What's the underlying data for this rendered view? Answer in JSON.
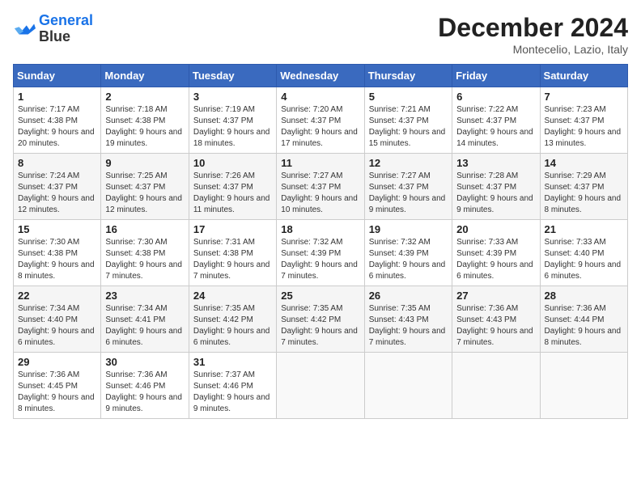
{
  "header": {
    "logo_line1": "General",
    "logo_line2": "Blue",
    "month": "December 2024",
    "location": "Montecelio, Lazio, Italy"
  },
  "weekdays": [
    "Sunday",
    "Monday",
    "Tuesday",
    "Wednesday",
    "Thursday",
    "Friday",
    "Saturday"
  ],
  "weeks": [
    [
      {
        "day": "1",
        "info": "Sunrise: 7:17 AM\nSunset: 4:38 PM\nDaylight: 9 hours and 20 minutes."
      },
      {
        "day": "2",
        "info": "Sunrise: 7:18 AM\nSunset: 4:38 PM\nDaylight: 9 hours and 19 minutes."
      },
      {
        "day": "3",
        "info": "Sunrise: 7:19 AM\nSunset: 4:37 PM\nDaylight: 9 hours and 18 minutes."
      },
      {
        "day": "4",
        "info": "Sunrise: 7:20 AM\nSunset: 4:37 PM\nDaylight: 9 hours and 17 minutes."
      },
      {
        "day": "5",
        "info": "Sunrise: 7:21 AM\nSunset: 4:37 PM\nDaylight: 9 hours and 15 minutes."
      },
      {
        "day": "6",
        "info": "Sunrise: 7:22 AM\nSunset: 4:37 PM\nDaylight: 9 hours and 14 minutes."
      },
      {
        "day": "7",
        "info": "Sunrise: 7:23 AM\nSunset: 4:37 PM\nDaylight: 9 hours and 13 minutes."
      }
    ],
    [
      {
        "day": "8",
        "info": "Sunrise: 7:24 AM\nSunset: 4:37 PM\nDaylight: 9 hours and 12 minutes."
      },
      {
        "day": "9",
        "info": "Sunrise: 7:25 AM\nSunset: 4:37 PM\nDaylight: 9 hours and 12 minutes."
      },
      {
        "day": "10",
        "info": "Sunrise: 7:26 AM\nSunset: 4:37 PM\nDaylight: 9 hours and 11 minutes."
      },
      {
        "day": "11",
        "info": "Sunrise: 7:27 AM\nSunset: 4:37 PM\nDaylight: 9 hours and 10 minutes."
      },
      {
        "day": "12",
        "info": "Sunrise: 7:27 AM\nSunset: 4:37 PM\nDaylight: 9 hours and 9 minutes."
      },
      {
        "day": "13",
        "info": "Sunrise: 7:28 AM\nSunset: 4:37 PM\nDaylight: 9 hours and 9 minutes."
      },
      {
        "day": "14",
        "info": "Sunrise: 7:29 AM\nSunset: 4:37 PM\nDaylight: 9 hours and 8 minutes."
      }
    ],
    [
      {
        "day": "15",
        "info": "Sunrise: 7:30 AM\nSunset: 4:38 PM\nDaylight: 9 hours and 8 minutes."
      },
      {
        "day": "16",
        "info": "Sunrise: 7:30 AM\nSunset: 4:38 PM\nDaylight: 9 hours and 7 minutes."
      },
      {
        "day": "17",
        "info": "Sunrise: 7:31 AM\nSunset: 4:38 PM\nDaylight: 9 hours and 7 minutes."
      },
      {
        "day": "18",
        "info": "Sunrise: 7:32 AM\nSunset: 4:39 PM\nDaylight: 9 hours and 7 minutes."
      },
      {
        "day": "19",
        "info": "Sunrise: 7:32 AM\nSunset: 4:39 PM\nDaylight: 9 hours and 6 minutes."
      },
      {
        "day": "20",
        "info": "Sunrise: 7:33 AM\nSunset: 4:39 PM\nDaylight: 9 hours and 6 minutes."
      },
      {
        "day": "21",
        "info": "Sunrise: 7:33 AM\nSunset: 4:40 PM\nDaylight: 9 hours and 6 minutes."
      }
    ],
    [
      {
        "day": "22",
        "info": "Sunrise: 7:34 AM\nSunset: 4:40 PM\nDaylight: 9 hours and 6 minutes."
      },
      {
        "day": "23",
        "info": "Sunrise: 7:34 AM\nSunset: 4:41 PM\nDaylight: 9 hours and 6 minutes."
      },
      {
        "day": "24",
        "info": "Sunrise: 7:35 AM\nSunset: 4:42 PM\nDaylight: 9 hours and 6 minutes."
      },
      {
        "day": "25",
        "info": "Sunrise: 7:35 AM\nSunset: 4:42 PM\nDaylight: 9 hours and 7 minutes."
      },
      {
        "day": "26",
        "info": "Sunrise: 7:35 AM\nSunset: 4:43 PM\nDaylight: 9 hours and 7 minutes."
      },
      {
        "day": "27",
        "info": "Sunrise: 7:36 AM\nSunset: 4:43 PM\nDaylight: 9 hours and 7 minutes."
      },
      {
        "day": "28",
        "info": "Sunrise: 7:36 AM\nSunset: 4:44 PM\nDaylight: 9 hours and 8 minutes."
      }
    ],
    [
      {
        "day": "29",
        "info": "Sunrise: 7:36 AM\nSunset: 4:45 PM\nDaylight: 9 hours and 8 minutes."
      },
      {
        "day": "30",
        "info": "Sunrise: 7:36 AM\nSunset: 4:46 PM\nDaylight: 9 hours and 9 minutes."
      },
      {
        "day": "31",
        "info": "Sunrise: 7:37 AM\nSunset: 4:46 PM\nDaylight: 9 hours and 9 minutes."
      },
      null,
      null,
      null,
      null
    ]
  ]
}
